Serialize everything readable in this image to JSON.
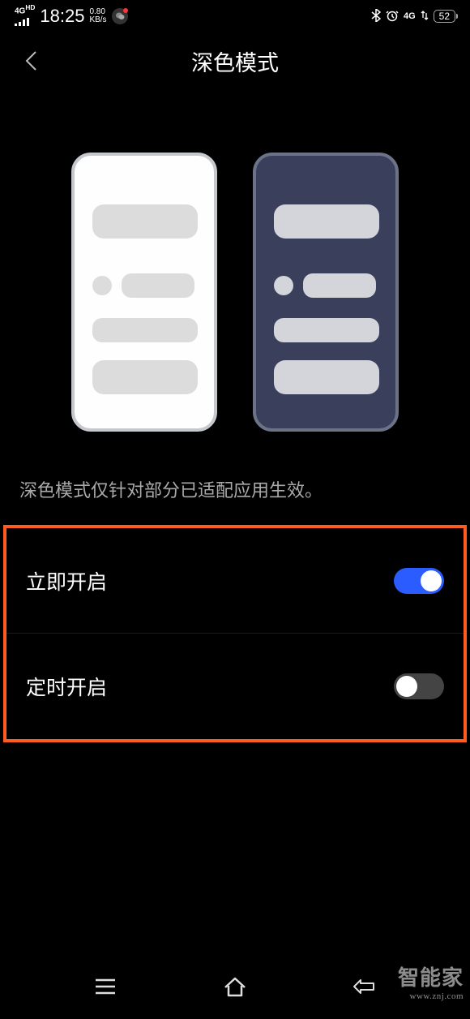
{
  "status": {
    "signal": "4G",
    "hd": "HD",
    "time": "18:25",
    "speed_top": "0.80",
    "speed_unit": "KB/s",
    "net_label": "4G",
    "battery": "52"
  },
  "header": {
    "title": "深色模式"
  },
  "description": "深色模式仅针对部分已适配应用生效。",
  "settings": {
    "enable_now": {
      "label": "立即开启",
      "value": true
    },
    "scheduled": {
      "label": "定时开启",
      "value": false
    }
  },
  "watermark": {
    "main": "智能家",
    "url": "www.znj.com"
  }
}
